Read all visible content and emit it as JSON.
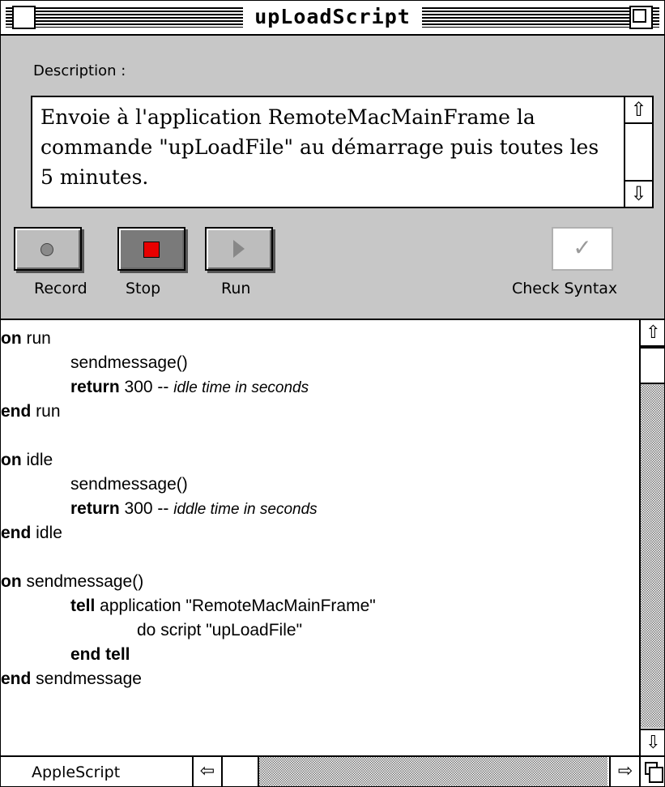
{
  "window": {
    "title": "upLoadScript"
  },
  "description": {
    "label": "Description :",
    "text": "Envoie à l'application RemoteMacMainFrame la commande \"upLoadFile\" au démarrage puis toutes les 5 minutes."
  },
  "controls": {
    "record_label": "Record",
    "stop_label": "Stop",
    "run_label": "Run",
    "check_syntax_label": "Check Syntax",
    "check_glyph": "✓"
  },
  "code": {
    "l1_kw": "on",
    "l1_rest": " run",
    "l2": "sendmessage()",
    "l3_kw": "return",
    "l3_rest": " 300 -- ",
    "l3_comment": "idle time in seconds",
    "l4_kw": "end",
    "l4_rest": " run",
    "l5": "",
    "l6_kw": "on",
    "l6_rest": " idle",
    "l7": "sendmessage()",
    "l8_kw": "return",
    "l8_rest": " 300 -- ",
    "l8_comment": "iddle time in seconds",
    "l9_kw": "end",
    "l9_rest": " idle",
    "l10": "",
    "l11_kw": "on",
    "l11_rest": " sendmessage()",
    "l12_kw": "tell",
    "l12_rest": " application \"RemoteMacMainFrame\"",
    "l13": "do script \"upLoadFile\"",
    "l14_kw": "end tell",
    "l15_kw": "end",
    "l15_rest": " sendmessage"
  },
  "status": {
    "language": "AppleScript"
  },
  "colors": {
    "panel": "#c7c7c7",
    "stop_square": "#e80000"
  }
}
